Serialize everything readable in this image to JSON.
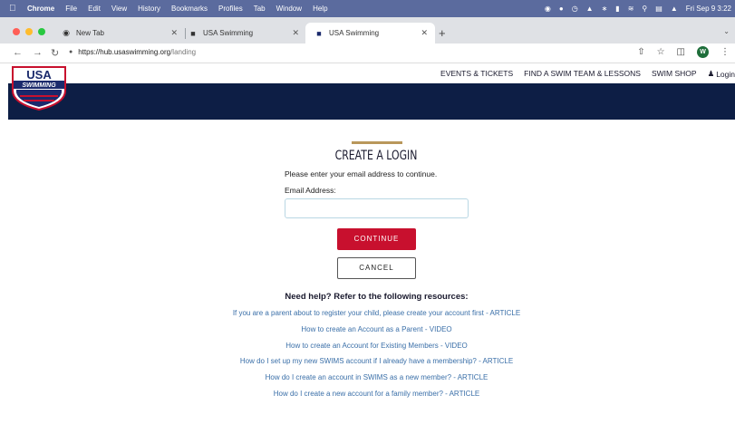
{
  "menubar": {
    "app": "Chrome",
    "items": [
      "File",
      "Edit",
      "View",
      "History",
      "Bookmarks",
      "Profiles",
      "Tab",
      "Window",
      "Help"
    ],
    "clock": "Fri Sep 9  3:22"
  },
  "tabs": [
    {
      "label": "New Tab"
    },
    {
      "label": "USA Swimming"
    },
    {
      "label": "USA Swimming"
    }
  ],
  "address": {
    "host": "https://hub.usaswimming.org",
    "path": "/landing"
  },
  "profile_initial": "W",
  "site": {
    "logo_top": "USA",
    "logo_bottom": "SWIMMING",
    "nav": [
      "EVENTS & TICKETS",
      "FIND A SWIM TEAM & LESSONS",
      "SWIM SHOP"
    ],
    "login_label": "Login"
  },
  "login": {
    "title": "CREATE A LOGIN",
    "prompt": "Please enter your email address to continue.",
    "email_label": "Email Address:",
    "email_value": "",
    "continue_label": "CONTINUE",
    "cancel_label": "CANCEL"
  },
  "help": {
    "heading": "Need help? Refer to the following resources:",
    "links": [
      "If you are a parent about to register your child, please create your account first - ARTICLE",
      "How to create an Account as a Parent - VIDEO",
      "How to create an Account for Existing Members - VIDEO",
      "How do I set up my new SWIMS account if I already have a membership? - ARTICLE",
      "How do I create an account in SWIMS as a new member? - ARTICLE",
      "How do I create a new account for a family member? - ARTICLE"
    ]
  },
  "colors": {
    "menubar": "#5b6b9e",
    "band": "#0d1e45",
    "continue": "#c8102e",
    "gold_rule": "#b9975b",
    "link": "#3a6fa8"
  }
}
